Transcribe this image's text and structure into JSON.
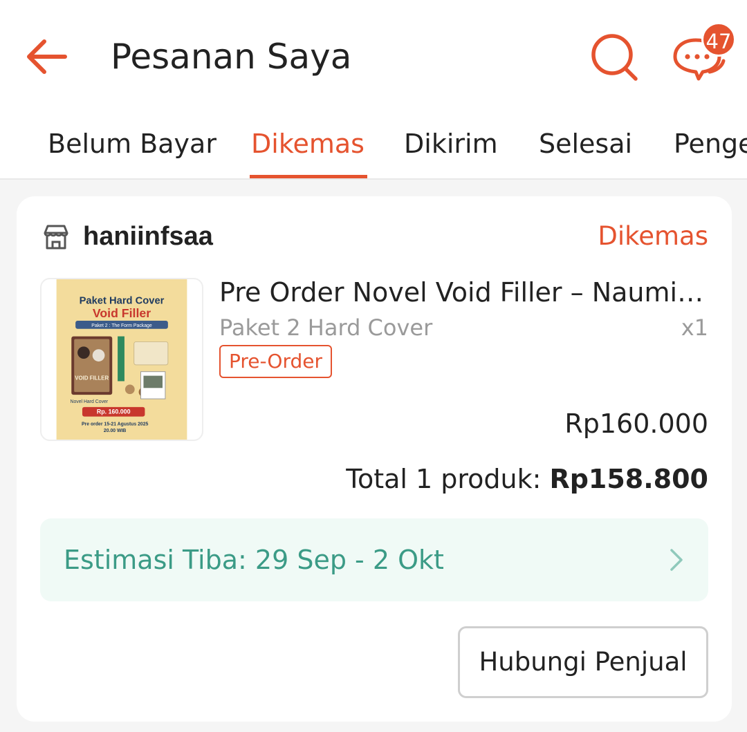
{
  "header": {
    "title": "Pesanan Saya",
    "chat_badge": "47",
    "icons": {
      "back": "arrow-left-icon",
      "search": "search-icon",
      "chat": "chat-bubbles-icon"
    },
    "accent_color": "#e5532f"
  },
  "tabs": [
    {
      "label": "Belum Bayar",
      "active": false
    },
    {
      "label": "Dikemas",
      "active": true
    },
    {
      "label": "Dikirim",
      "active": false
    },
    {
      "label": "Selesai",
      "active": false
    },
    {
      "label": "Pengembalian",
      "active": false
    }
  ],
  "order": {
    "shop_icon": "store-icon",
    "shop_name": "haniinfsaa",
    "status": "Dikemas",
    "product": {
      "name": "Pre Order Novel Void Filler – Naumi Al...",
      "variant": "Paket 2 Hard Cover",
      "quantity": "x1",
      "badge": "Pre-Order",
      "price": "Rp160.000",
      "image": {
        "title_line1": "Paket Hard Cover",
        "title_line2": "Void Filler",
        "subtitle": "Paket 2 : The Form Package",
        "book_title": "VOID FILLER",
        "book_label": "Novel Hard Cover",
        "price_tag": "Rp. 160.000",
        "preorder_line1": "Pre order 15-21 Agustus 2025",
        "preorder_line2": "20.00 WIB"
      }
    },
    "total_label": "Total 1 produk:",
    "total_value": "Rp158.800",
    "eta": {
      "text": "Estimasi Tiba: 29 Sep - 2 Okt",
      "color": "#3b9b86",
      "icon": "chevron-right-icon"
    },
    "contact_button": "Hubungi Penjual"
  }
}
